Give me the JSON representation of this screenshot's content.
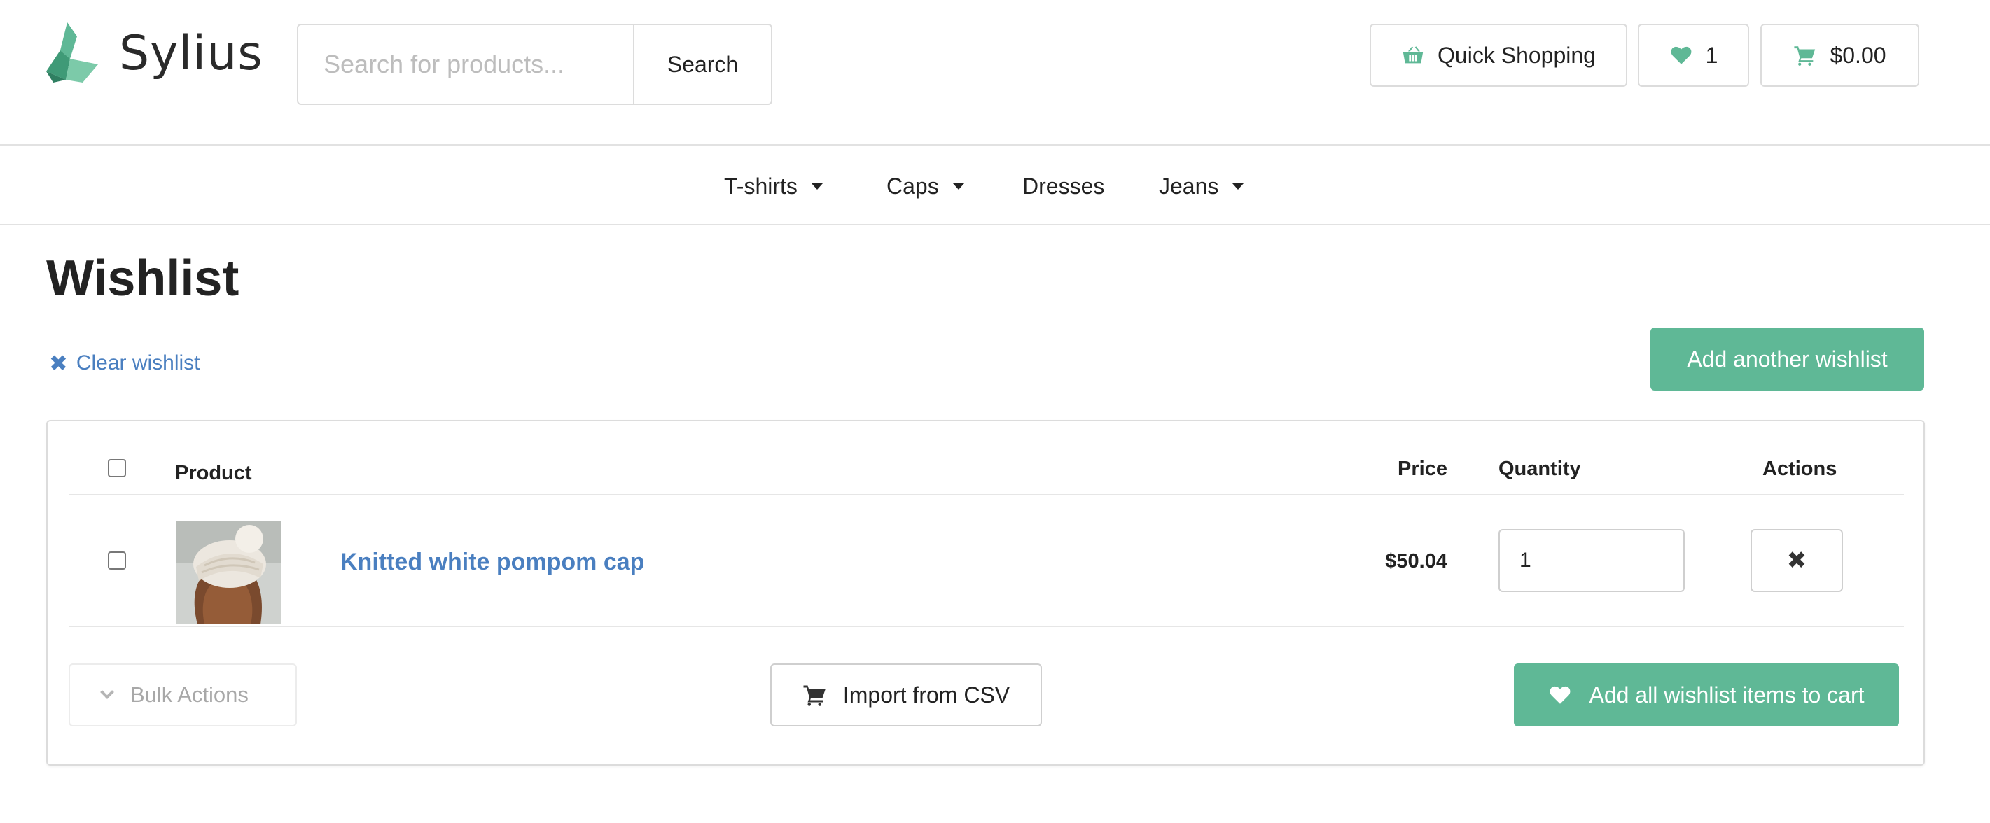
{
  "header": {
    "logo_text": "Sylius",
    "search_placeholder": "Search for products...",
    "search_button": "Search",
    "quick_shopping": "Quick Shopping",
    "wishlist_count": "1",
    "cart_total": "$0.00"
  },
  "nav": {
    "items": [
      {
        "label": "T-shirts",
        "has_dropdown": true
      },
      {
        "label": "Caps",
        "has_dropdown": true
      },
      {
        "label": "Dresses",
        "has_dropdown": false
      },
      {
        "label": "Jeans",
        "has_dropdown": true
      }
    ]
  },
  "page": {
    "title": "Wishlist",
    "clear_wishlist": "Clear wishlist",
    "add_another_wishlist": "Add another wishlist"
  },
  "table": {
    "headers": {
      "product": "Product",
      "price": "Price",
      "quantity": "Quantity",
      "actions": "Actions"
    },
    "rows": [
      {
        "name": "Knitted white pompom cap",
        "price": "$50.04",
        "quantity": "1"
      }
    ]
  },
  "footer_actions": {
    "bulk_actions": "Bulk Actions",
    "import_csv": "Import from CSV",
    "add_all_to_cart": "Add all wishlist items to cart"
  },
  "colors": {
    "brand_green": "#5fb896",
    "link_blue": "#4a7fc0"
  },
  "icons": [
    "sylius-logo-icon",
    "basket-icon",
    "heart-icon",
    "cart-icon",
    "close-icon",
    "chevron-down-icon"
  ]
}
